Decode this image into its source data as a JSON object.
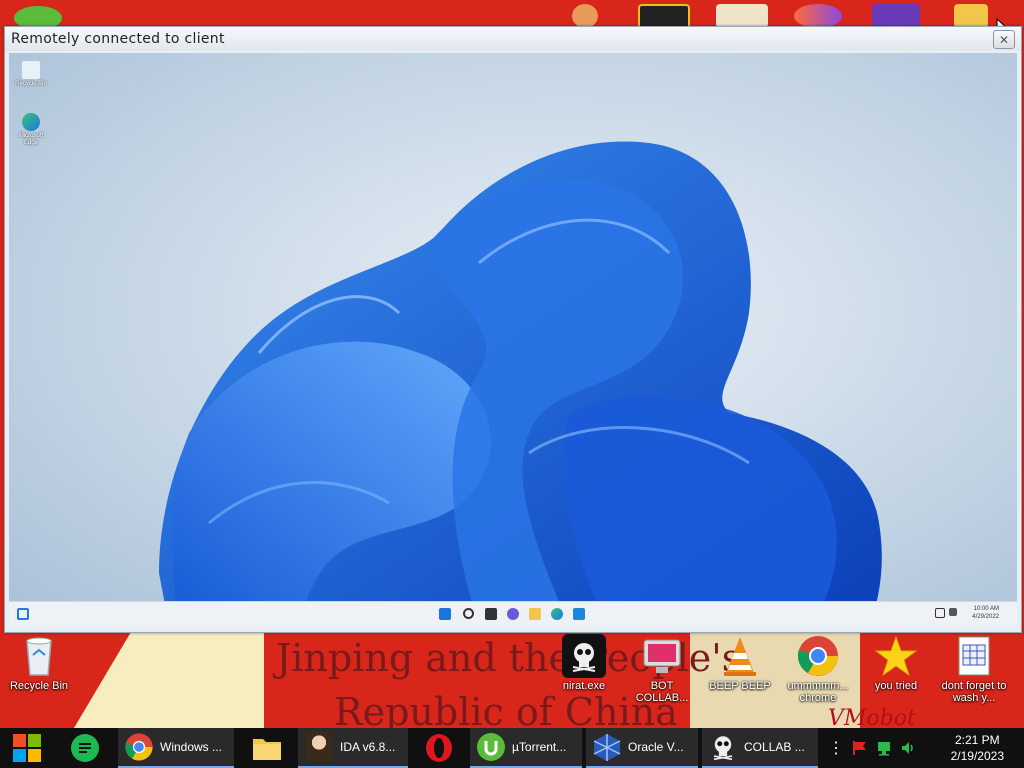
{
  "remote_window": {
    "title": "Remotely connected to client",
    "close_glyph": "✕",
    "desktop_icons": [
      {
        "label": "Recycle Bin",
        "icon": "recycle-bin-icon"
      },
      {
        "label": "Microsoft Edge",
        "icon": "edge-icon"
      }
    ],
    "taskbar": {
      "time": "10:00 AM",
      "date": "4/29/2022"
    }
  },
  "host_desktop": {
    "poster_line1": "Jinping and the People's",
    "poster_line2": "Republic of China",
    "poster_corner": "VMobot",
    "icons": [
      {
        "label": "Recycle Bin",
        "icon": "recycle-bin-icon"
      },
      {
        "label": "nirat.exe",
        "icon": "skull-icon"
      },
      {
        "label": "BOT COLLAB...",
        "icon": "bot-collab-icon"
      },
      {
        "label": "BEEP BEEP",
        "icon": "vlc-cone-icon"
      },
      {
        "label": "ummmmm... chrome",
        "icon": "chrome-icon"
      },
      {
        "label": "you tried",
        "icon": "star-icon"
      },
      {
        "label": "dont forget to wash y...",
        "icon": "calendar-file-icon"
      }
    ]
  },
  "taskbar": {
    "items": [
      {
        "label": "",
        "icon": "windows-start-icon"
      },
      {
        "label": "",
        "icon": "spotify-like-icon"
      },
      {
        "label": "Windows ...",
        "icon": "chrome-icon"
      },
      {
        "label": "",
        "icon": "folder-icon"
      },
      {
        "label": "IDA v6.8...",
        "icon": "ida-icon"
      },
      {
        "label": "",
        "icon": "opera-icon"
      },
      {
        "label": "µTorrent...",
        "icon": "utorrent-icon"
      },
      {
        "label": "Oracle V...",
        "icon": "virtualbox-icon"
      },
      {
        "label": "COLLAB ...",
        "icon": "skull-icon"
      }
    ],
    "clock": {
      "time": "2:21 PM",
      "date": "2/19/2023"
    }
  },
  "colors": {
    "host_bg": "#d8261a",
    "accent_blue": "#1a6ae0",
    "taskbar_bg": "#101010"
  }
}
